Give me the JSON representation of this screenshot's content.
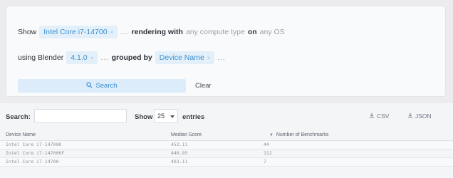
{
  "filters": {
    "show_label": "Show",
    "cpu_chip": "Intel Core i7-14700",
    "rendering_label": "rendering with",
    "compute_type": "any compute type",
    "on_label": "on",
    "os": "any OS",
    "using_label": "using Blender",
    "version_chip": "4.1.0",
    "grouped_label": "grouped by",
    "group_chip": "Device Name",
    "dots": "...",
    "chip_remove": "×",
    "search_button": "Search",
    "clear_button": "Clear"
  },
  "table_controls": {
    "search_label": "Search:",
    "search_value": "",
    "show_label": "Show",
    "entries_value": "25",
    "entries_label": "entries",
    "csv_button": "CSV",
    "json_button": "JSON"
  },
  "table": {
    "headers": [
      "Device Name",
      "Median Score",
      "Number of Benchmarks"
    ],
    "rows": [
      [
        "Intel Core i7-14700K",
        "452.11",
        "44"
      ],
      [
        "Intel Core i7-14700KF",
        "446.95",
        "112"
      ],
      [
        "Intel Core i7-14700",
        "403.11",
        "7"
      ]
    ]
  },
  "colors": {
    "accent": "#3a8fd1",
    "chip_bg": "#e3f0fa",
    "page_bg": "#ececef"
  }
}
